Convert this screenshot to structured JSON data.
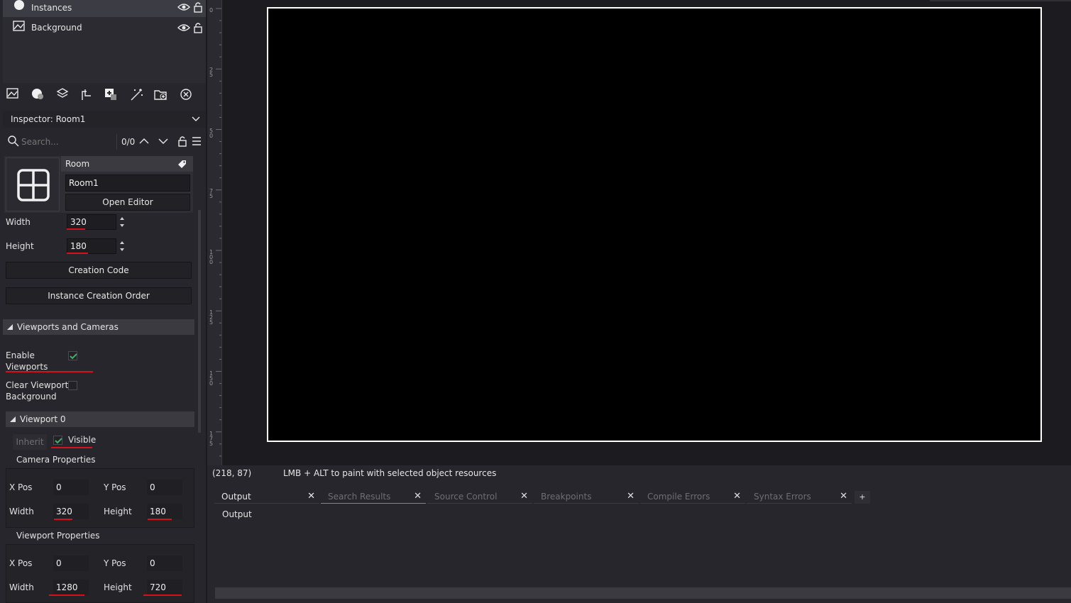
{
  "layers": [
    {
      "label": "Instances",
      "selected": true
    },
    {
      "label": "Background",
      "selected": false
    }
  ],
  "inspector": {
    "title": "Inspector: Room1",
    "search_placeholder": "Search...",
    "search_count": "0/0"
  },
  "room": {
    "type_label": "Room",
    "name": "Room1",
    "open_editor": "Open Editor",
    "width_label": "Width",
    "width": "320",
    "height_label": "Height",
    "height": "180",
    "creation_code": "Creation Code",
    "instance_creation_order": "Instance Creation Order"
  },
  "viewports": {
    "section_title": "Viewports and Cameras",
    "enable_label_1": "Enable",
    "enable_label_2": "Viewports",
    "enable_checked": true,
    "clear_label_1": "Clear Viewport",
    "clear_label_2": "Background",
    "clear_checked": false,
    "viewport0_title": "Viewport 0",
    "inherit": "Inherit",
    "visible": "Visible",
    "visible_checked": true,
    "camera_title": "Camera Properties",
    "camera": {
      "xpos_label": "X Pos",
      "xpos": "0",
      "ypos_label": "Y Pos",
      "ypos": "0",
      "width_label": "Width",
      "width": "320",
      "height_label": "Height",
      "height": "180"
    },
    "viewport_title": "Viewport Properties",
    "viewport": {
      "xpos_label": "X Pos",
      "xpos": "0",
      "ypos_label": "Y Pos",
      "ypos": "0",
      "width_label": "Width",
      "width": "1280",
      "height_label": "Height",
      "height": "720"
    }
  },
  "ruler_labels": [
    "0",
    "25",
    "50",
    "75",
    "100",
    "125",
    "150",
    "175"
  ],
  "status": {
    "coords": "(218, 87)",
    "hint": "LMB + ALT to paint with selected object resources"
  },
  "bottom_tabs": [
    {
      "label": "Output",
      "active": true
    },
    {
      "label": "Search Results",
      "active": false
    },
    {
      "label": "Source Control",
      "active": false
    },
    {
      "label": "Breakpoints",
      "active": false
    },
    {
      "label": "Compile Errors",
      "active": false
    },
    {
      "label": "Syntax Errors",
      "active": false
    }
  ],
  "add_tab": "+",
  "output_title": "Output",
  "colors": {
    "accent_green": "#3fae6b",
    "highlight_red": "#d3121b"
  }
}
